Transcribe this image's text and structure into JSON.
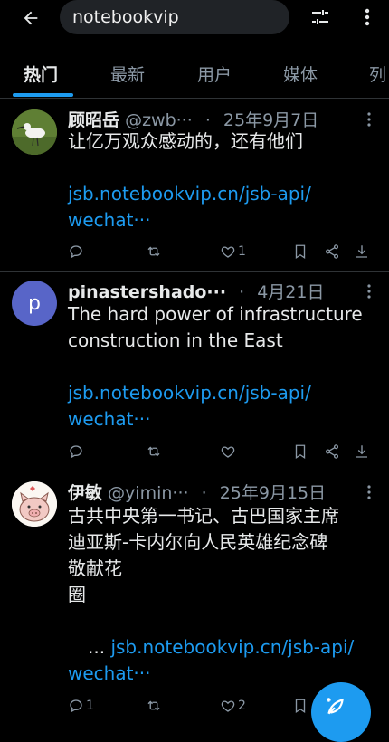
{
  "search": {
    "query": "notebookvip"
  },
  "tabs": [
    "热门",
    "最新",
    "用户",
    "媒体",
    "列"
  ],
  "posts": [
    {
      "name": "顾昭岳",
      "handle": "@zwb···",
      "date": "25年9月7日",
      "text_lines": [
        "让亿万观众感动的，还有他们"
      ],
      "link_lines": [
        "jsb.notebookvip.cn/jsb-api/",
        "wechat···"
      ],
      "like_count": "1",
      "reply_count": ""
    },
    {
      "name": "pinastershado···",
      "handle": "",
      "avatar_letter": "p",
      "date": "4月21日",
      "text_lines": [
        "The hard power of infrastructure",
        "construction in the East"
      ],
      "link_lines": [
        "jsb.notebookvip.cn/jsb-api/",
        "wechat···"
      ],
      "like_count": "",
      "reply_count": ""
    },
    {
      "name": "伊敏",
      "handle": "@yimin···",
      "date": "25年9月15日",
      "text_lines": [
        "古共中央第一书记、古巴国家主席",
        "迪亚斯-卡内尔向人民英雄纪念碑",
        "敬献花",
        "圈"
      ],
      "link_prefix": "... ",
      "link_lines": [
        "jsb.notebookvip.cn/jsb-api/",
        "wechat···"
      ],
      "like_count": "2",
      "reply_count": "1"
    }
  ],
  "colors": {
    "accent": "#1d9bf0",
    "background": "#000000",
    "muted": "#8b98a5"
  },
  "icons": [
    "back-arrow-icon",
    "filter-icon",
    "more-vertical-icon",
    "reply-icon",
    "retweet-icon",
    "like-icon",
    "bookmark-icon",
    "share-icon",
    "download-icon",
    "compose-icon"
  ]
}
